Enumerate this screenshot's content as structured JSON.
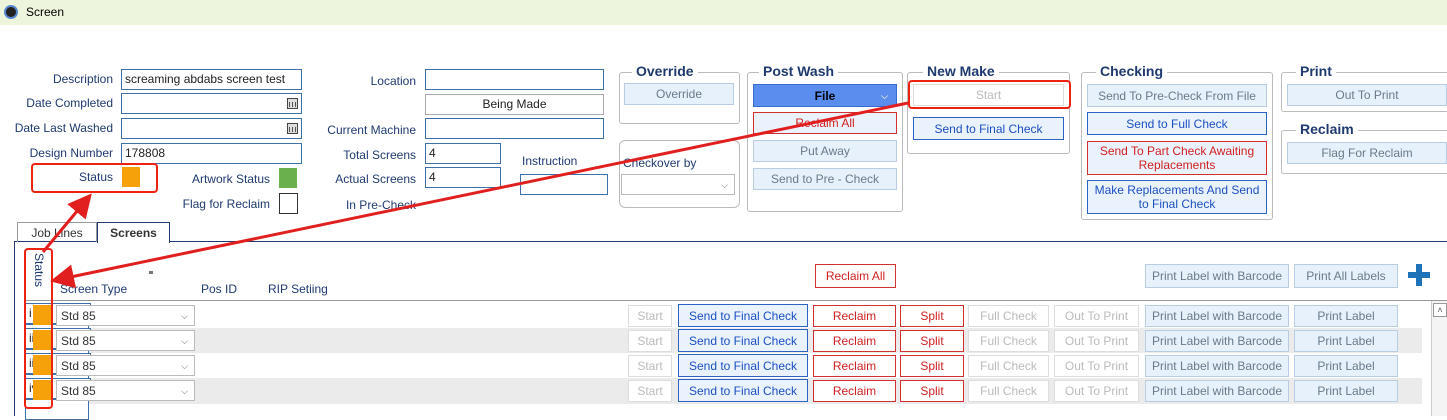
{
  "window": {
    "title": "Screen"
  },
  "details": {
    "description_label": "Description",
    "description_value": "screaming abdabs screen test",
    "date_completed_label": "Date Completed",
    "date_last_washed_label": "Date Last Washed",
    "design_number_label": "Design Number",
    "design_number_value": "178808",
    "status_label": "Status",
    "artwork_status_label": "Artwork Status",
    "flag_reclaim_label": "Flag for Reclaim",
    "location_label": "Location",
    "location_value": "Being Made",
    "current_machine_label": "Current Machine",
    "total_screens_label": "Total Screens",
    "total_screens_value": "4",
    "actual_screens_label": "Actual Screens",
    "actual_screens_value": "4",
    "in_precheck_label": "In Pre-Check",
    "instruction_label": "Instruction",
    "checkover_label": "Checkover by"
  },
  "colors": {
    "status": "#f7a10a",
    "artwork_status": "#6ab04c",
    "accent_red": "#e21f1f"
  },
  "override": {
    "title": "Override",
    "button": "Override"
  },
  "post_wash": {
    "title": "Post Wash",
    "file": "File",
    "reclaim_all": "Reclaim All",
    "put_away": "Put Away",
    "send_pre_check": "Send to Pre - Check"
  },
  "new_make": {
    "title": "New Make",
    "start": "Start",
    "send_final": "Send to Final Check"
  },
  "checking": {
    "title": "Checking",
    "pre_check_file": "Send To Pre-Check From File",
    "full_check": "Send to Full Check",
    "part_check": "Send To Part Check Awaiting Replacements",
    "make_replacements": "Make Replacements And Send to Final Check"
  },
  "print": {
    "title": "Print",
    "out_to_print": "Out To Print"
  },
  "reclaim": {
    "title": "Reclaim",
    "flag": "Flag For Reclaim"
  },
  "tabs": {
    "job_lines": "Job Lines",
    "screens": "Screens"
  },
  "grid": {
    "status_header": "Status",
    "col_screen_type": "Screen Type",
    "col_pos_id": "Pos ID",
    "col_rip": "RIP Setiing",
    "reclaim_all": "Reclaim All",
    "print_label_barcode": "Print Label with Barcode",
    "print_all_labels": "Print All Labels",
    "rows": [
      {
        "screen_type": "Std 85",
        "pos_id": "i"
      },
      {
        "screen_type": "Std 85",
        "pos_id": "ii"
      },
      {
        "screen_type": "Std 85",
        "pos_id": "iii"
      },
      {
        "screen_type": "Std 85",
        "pos_id": "iv"
      }
    ],
    "row_buttons": {
      "start": "Start",
      "send_final": "Send to Final Check",
      "reclaim": "Reclaim",
      "split": "Split",
      "full_check": "Full Check",
      "out_to_print": "Out To Print",
      "print_label_barcode": "Print Label with Barcode",
      "print_label": "Print Label"
    }
  }
}
